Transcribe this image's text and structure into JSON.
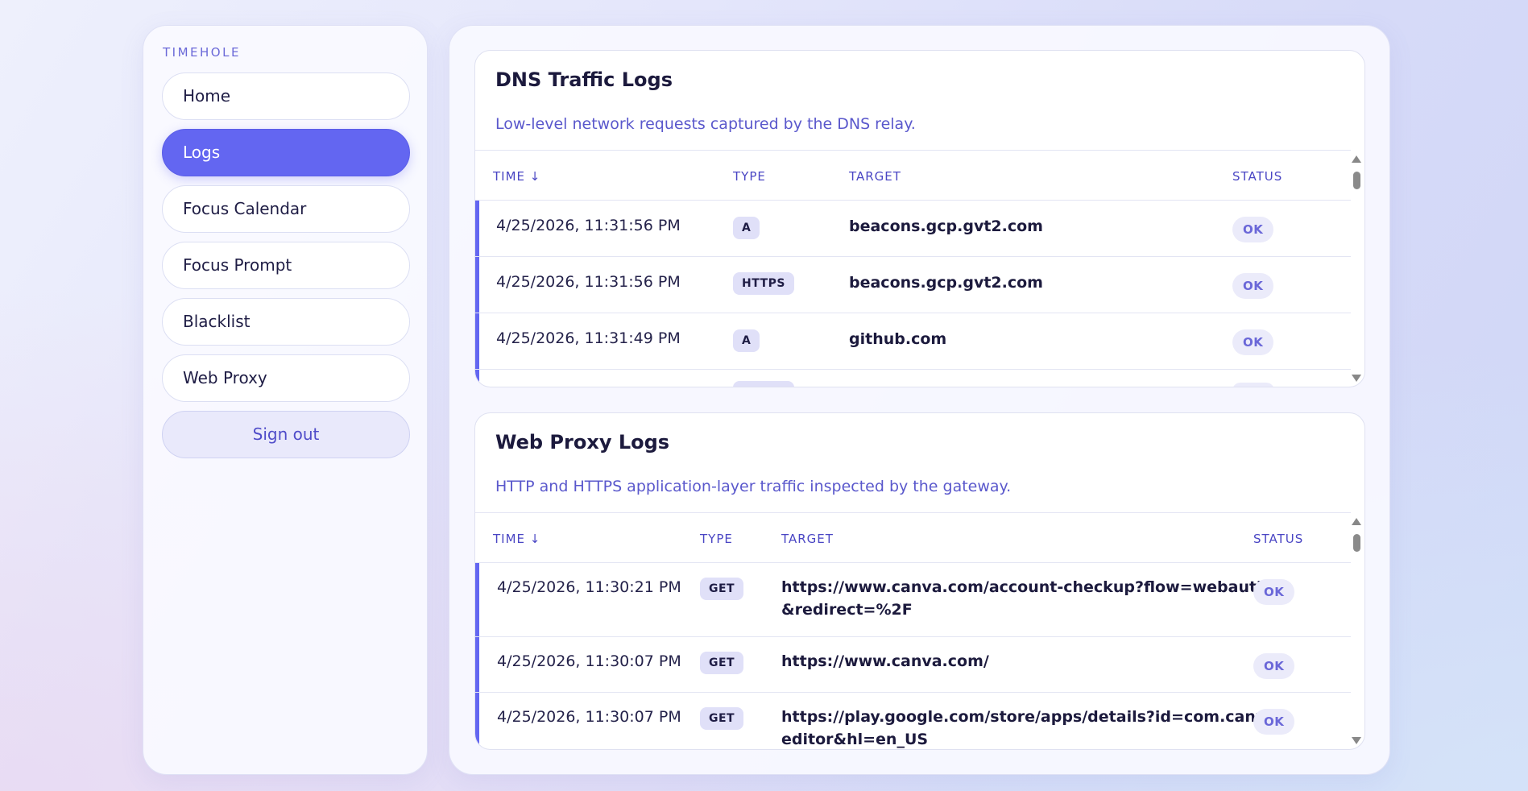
{
  "sidebar": {
    "brand": "TIMEHOLE",
    "items": [
      {
        "label": "Home",
        "active": false
      },
      {
        "label": "Logs",
        "active": true
      },
      {
        "label": "Focus Calendar",
        "active": false
      },
      {
        "label": "Focus Prompt",
        "active": false
      },
      {
        "label": "Blacklist",
        "active": false
      },
      {
        "label": "Web Proxy",
        "active": false
      }
    ],
    "signout_label": "Sign out"
  },
  "dns": {
    "title": "DNS Traffic Logs",
    "subtitle": "Low-level network requests captured by the DNS relay.",
    "columns": {
      "time": "TIME ↓",
      "type": "TYPE",
      "target": "TARGET",
      "status": "STATUS"
    },
    "rows": [
      {
        "time": "4/25/2026, 11:31:56 PM",
        "type": "A",
        "target": "beacons.gcp.gvt2.com",
        "status": "OK"
      },
      {
        "time": "4/25/2026, 11:31:56 PM",
        "type": "HTTPS",
        "target": "beacons.gcp.gvt2.com",
        "status": "OK"
      },
      {
        "time": "4/25/2026, 11:31:49 PM",
        "type": "A",
        "target": "github.com",
        "status": "OK"
      }
    ]
  },
  "proxy": {
    "title": "Web Proxy Logs",
    "subtitle": "HTTP and HTTPS application-layer traffic inspected by the gateway.",
    "columns": {
      "time": "TIME ↓",
      "type": "TYPE",
      "target": "TARGET",
      "status": "STATUS"
    },
    "rows": [
      {
        "time": "4/25/2026, 11:30:21 PM",
        "type": "GET",
        "target_line1": "https://www.canva.com/account-checkup?flow=webauthn",
        "target_line2": "&redirect=%2F",
        "status": "OK"
      },
      {
        "time": "4/25/2026, 11:30:07 PM",
        "type": "GET",
        "target_line1": "https://www.canva.com/",
        "target_line2": "",
        "status": "OK"
      },
      {
        "time": "4/25/2026, 11:30:07 PM",
        "type": "GET",
        "target_line1": "https://play.google.com/store/apps/details?id=com.canva.",
        "target_line2": "editor&hl=en_US",
        "status": "OK"
      }
    ]
  },
  "colors": {
    "accent": "#6366f1",
    "status_text": "#6a67d8",
    "heading": "#1c1a3d"
  },
  "icons": {
    "scroll_up": "triangle-up-icon",
    "scroll_down": "triangle-down-icon"
  }
}
